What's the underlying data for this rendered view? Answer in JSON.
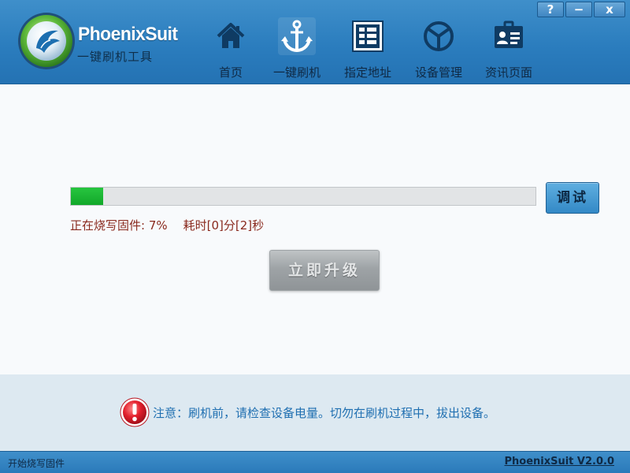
{
  "app": {
    "title": "PhoenixSuit",
    "subtitle": "一键刷机工具"
  },
  "window_controls": {
    "help": "?",
    "minimize": "−",
    "close": "x"
  },
  "nav": {
    "items": [
      {
        "label": "首页",
        "icon": "house-icon"
      },
      {
        "label": "一键刷机",
        "icon": "anchor-icon"
      },
      {
        "label": "指定地址",
        "icon": "grid-icon"
      },
      {
        "label": "设备管理",
        "icon": "device-icon"
      },
      {
        "label": "资讯页面",
        "icon": "info-card-icon"
      }
    ],
    "active_index": 1
  },
  "main": {
    "progress": {
      "percent": 7
    },
    "status_text": "正在烧写固件: 7%",
    "elapsed_text": "耗时[0]分[2]秒",
    "debug_button": "调试",
    "upgrade_button": "立即升级"
  },
  "notice": {
    "text": "注意：刷机前，请检查设备电量。切勿在刷机过程中，拔出设备。",
    "icon": "alert-exclamation-icon"
  },
  "statusbar": {
    "left": "开始烧写固件",
    "right": "PhoenixSuit V2.0.0"
  },
  "colors": {
    "header": "#2b7dbe",
    "progress_fill": "#17b132",
    "status_text": "#8a2a1e",
    "notice_text": "#1f6fb1",
    "notice_background": "#dde9f1"
  }
}
